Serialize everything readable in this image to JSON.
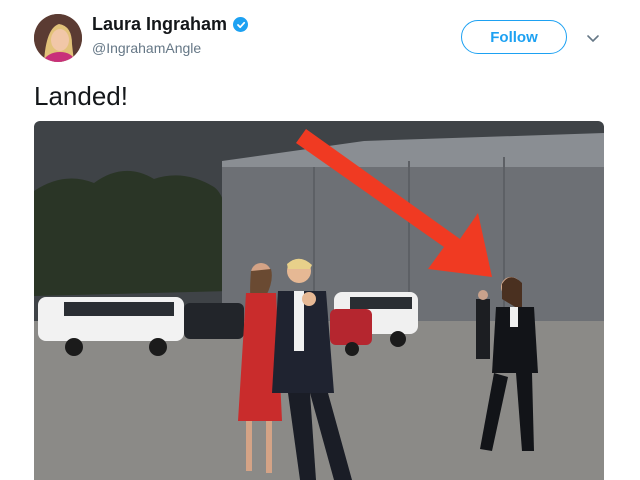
{
  "tweet": {
    "author": {
      "display_name": "Laura Ingraham",
      "handle": "@IngrahamAngle",
      "verified": true,
      "avatar_icon": "profile-photo"
    },
    "follow_label": "Follow",
    "text": "Landed!",
    "media": {
      "kind": "photo"
    }
  },
  "colors": {
    "brand_blue": "#1da1f2",
    "name_text": "#14171a",
    "handle_text": "#657786",
    "arrow_red": "#f03a22"
  }
}
